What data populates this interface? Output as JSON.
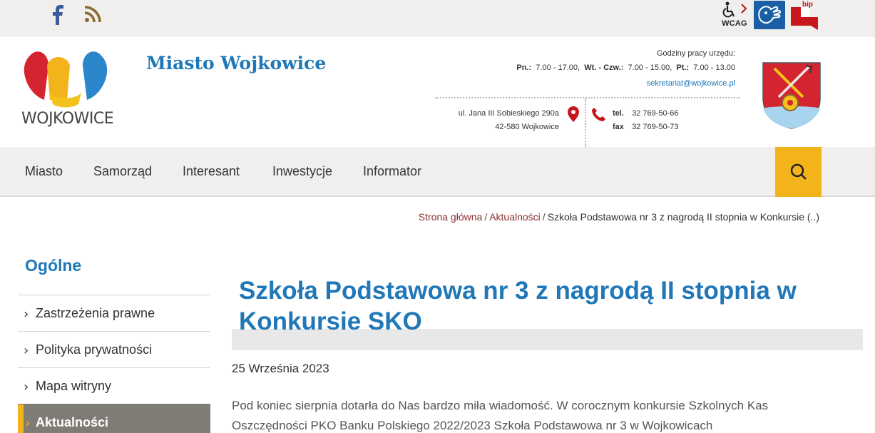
{
  "topbar": {
    "icons": [
      "facebook-icon",
      "rss-icon",
      "wcag-accessibility-icon",
      "sign-language-icon",
      "bip-icon"
    ],
    "wcag_label": "WCAG",
    "bip_label": "bip"
  },
  "header": {
    "logo_text": "WOJKOWICE",
    "site_title": "Miasto Wojkowice",
    "hours_title": "Godziny pracy urzędu:",
    "hours": {
      "d1": "Pn.:",
      "h1": "7.00 - 17.00,",
      "d2": "Wt. - Czw.:",
      "h2": "7.00 - 15.00,",
      "d3": "Pt.:",
      "h3": "7.00 - 13.00"
    },
    "email": "sekretariat@wojkowice.pl",
    "address_line1": "ul. Jana III Sobieskiego 290a",
    "address_line2": "42-580 Wojkowice",
    "tel_label": "tel.",
    "tel_value": "32 769-50-66",
    "fax_label": "fax",
    "fax_value": "32 769-50-73"
  },
  "nav": {
    "items": [
      {
        "label": "Miasto"
      },
      {
        "label": "Samorząd"
      },
      {
        "label": "Interesant"
      },
      {
        "label": "Inwestycje"
      },
      {
        "label": "Informator"
      }
    ]
  },
  "breadcrumb": {
    "home": "Strona główna",
    "section": "Aktualności",
    "current": "Szkoła Podstawowa nr 3 z nagrodą II stopnia w Konkursie (..)",
    "separator": "/"
  },
  "sidebar": {
    "heading": "Ogólne",
    "items": [
      {
        "label": "Zastrzeżenia prawne"
      },
      {
        "label": "Polityka prywatności"
      },
      {
        "label": "Mapa witryny"
      },
      {
        "label": "Aktualności"
      }
    ]
  },
  "article": {
    "title": "Szkoła Podstawowa nr 3 z nagrodą II stopnia w Konkursie SKO",
    "date": "25 Września 2023",
    "body": "Pod koniec sierpnia dotarła do Nas bardzo miła wiadomość. W corocznym konkursie Szkolnych Kas Oszczędności PKO Banku Polskiego 2022/2023 Szkoła Podstawowa nr 3 w Wojkowicach"
  },
  "colors": {
    "accent_blue": "#2078b8",
    "accent_yellow": "#f3b41b",
    "breadcrumb_red": "#8b2e2e",
    "active_grey": "#7e7c74"
  }
}
